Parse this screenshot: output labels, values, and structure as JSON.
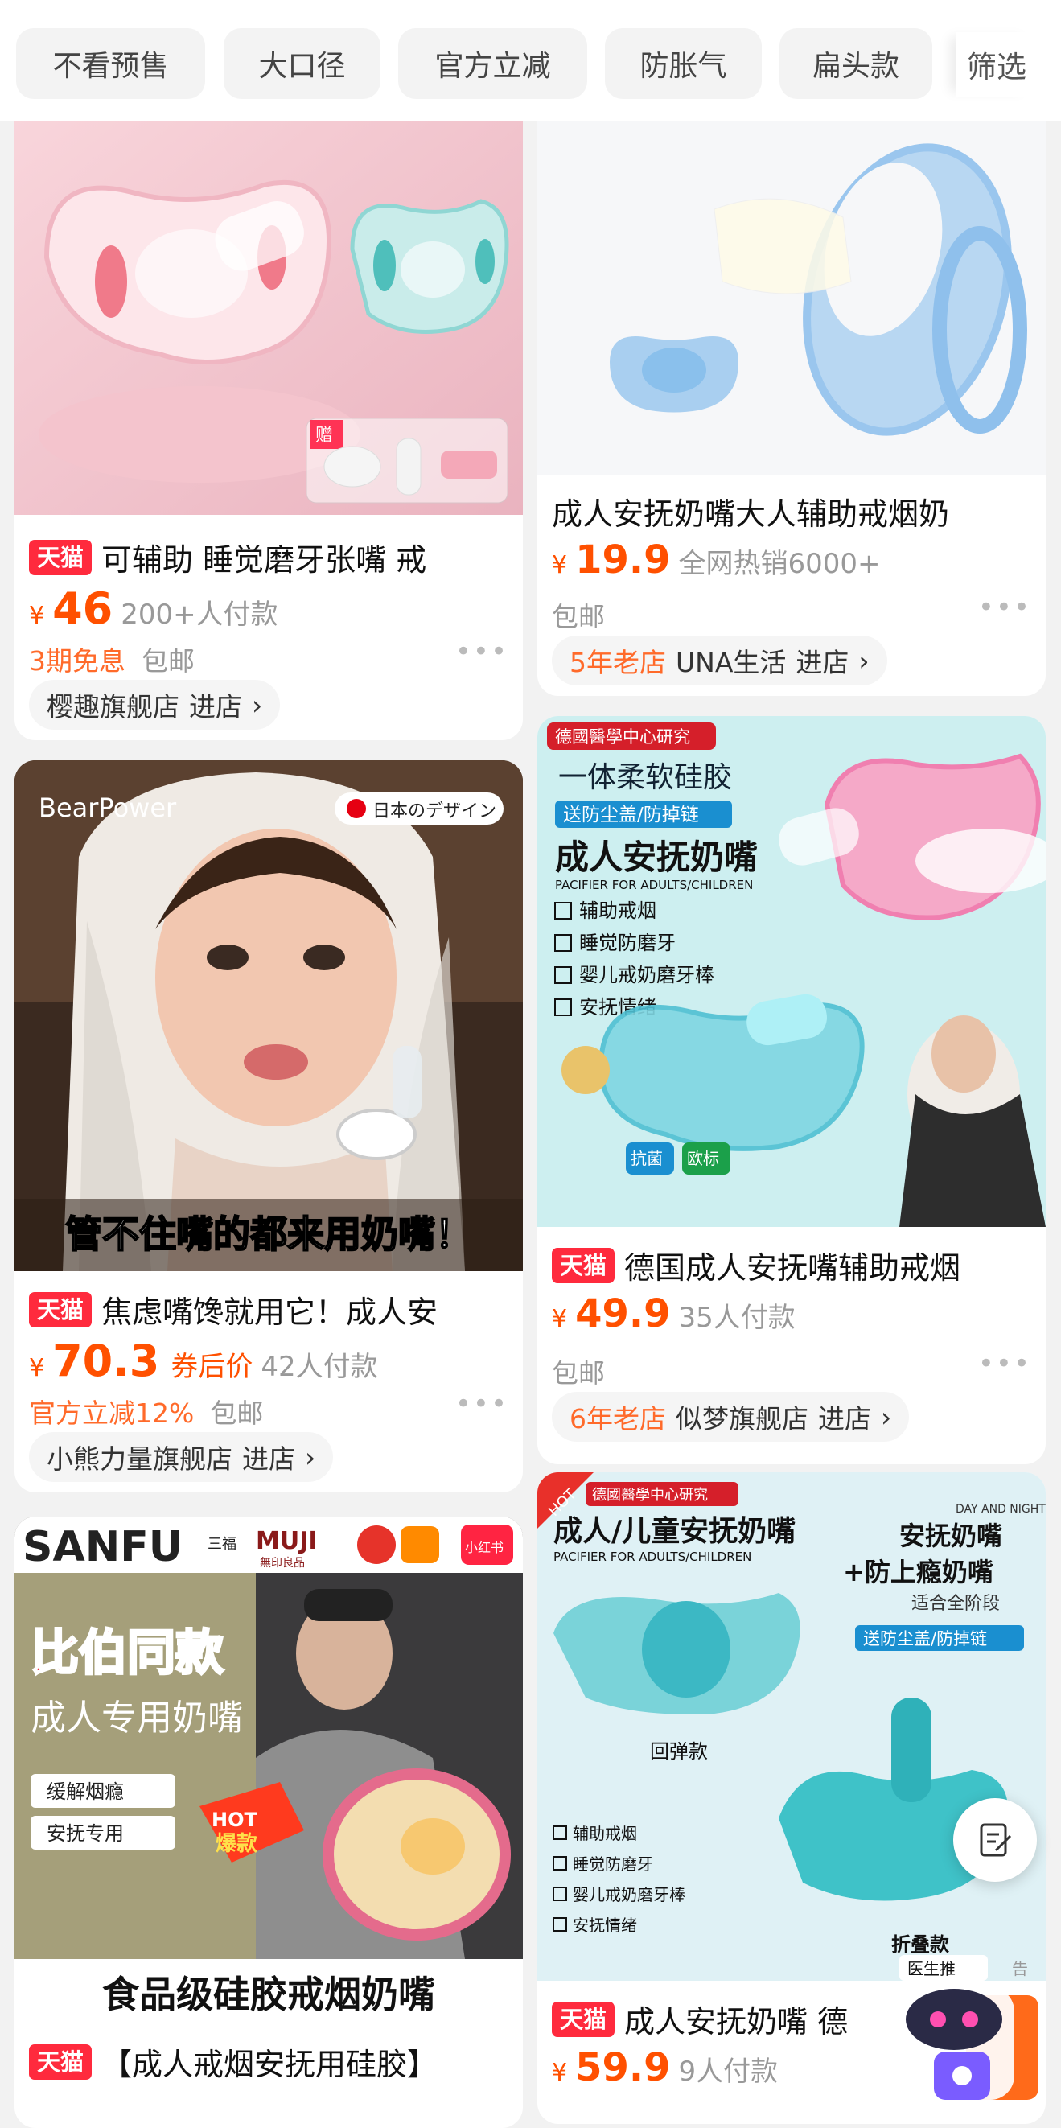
{
  "filters": [
    "不看预售",
    "大口径",
    "官方立减",
    "防胀气",
    "扁头款"
  ],
  "screen_label": "筛选",
  "products": [
    {
      "title": "可辅助 睡觉磨牙张嘴 戒",
      "tmall": "天猫",
      "price": "46",
      "sold": "200+人付款",
      "line2": [
        "3期免息",
        "包邮"
      ],
      "shop": "樱趣旗舰店",
      "enter": "进店",
      "image_text": [
        "赠"
      ]
    },
    {
      "title": "成人安抚奶嘴大人辅助戒烟奶",
      "price": "19.9",
      "sold": "全网热销6000+",
      "line2": [
        "包邮"
      ],
      "shop_age": "5年老店",
      "shop": "UNA生活",
      "enter": "进店"
    },
    {
      "title": "焦虑嘴馋就用它！成人安",
      "tmall": "天猫",
      "price": "70.3",
      "coupon": "券后价",
      "sold": "42人付款",
      "line2": [
        "官方立减12%",
        "包邮"
      ],
      "shop": "小熊力量旗舰店",
      "enter": "进店",
      "image_text": [
        "BearPower",
        "日本のデザイン",
        "管不住嘴的都来用奶嘴！"
      ]
    },
    {
      "title": "德国成人安抚嘴辅助戒烟",
      "tmall": "天猫",
      "price": "49.9",
      "sold": "35人付款",
      "line2": [
        "包邮"
      ],
      "shop_age": "6年老店",
      "shop": "似梦旗舰店",
      "enter": "进店",
      "image_text": [
        "德國醫學中心研究",
        "一体柔软硅胶",
        "送防尘盖/防掉链",
        "成人安抚奶嘴",
        "PACIFIER FOR ADULTS/CHILDREN",
        "辅助戒烟",
        "睡觉防磨牙",
        "婴儿戒奶磨牙棒",
        "安抚情绪",
        "抗菌",
        "欧标"
      ]
    },
    {
      "title": "【成人戒烟安抚用硅胶】",
      "tmall": "天猫",
      "image_text": [
        "SANFU",
        "三福",
        "MUJI",
        "無印良品",
        "小红书",
        "比伯同款",
        "成人专用奶嘴",
        "缓解烟瘾",
        "安抚专用",
        "HOT",
        "爆款",
        "食品级硅胶戒烟奶嘴"
      ]
    },
    {
      "title": "成人安抚奶嘴  德",
      "tmall": "天猫",
      "price": "59.9",
      "sold": "9人付款",
      "image_text": [
        "HOT",
        "德國醫學中心研究",
        "成人/儿童安抚奶嘴",
        "PACIFIER FOR ADULTS/CHILDREN",
        "DAY AND NIGHT",
        "安抚奶嘴",
        "+防上瘾奶嘴",
        "适合全阶段",
        "送防尘盖/防掉链",
        "回弹款",
        "折叠款",
        "辅助戒烟",
        "睡觉防磨牙",
        "婴儿戒奶磨牙棒",
        "安抚情绪",
        "医生推",
        "告"
      ]
    }
  ],
  "icons": [
    "edit-icon",
    "assistant-robot-icon"
  ],
  "colors": {
    "price": "#ff5000",
    "tmall": "#ff2a3d",
    "bg": "#f2f2f2"
  }
}
